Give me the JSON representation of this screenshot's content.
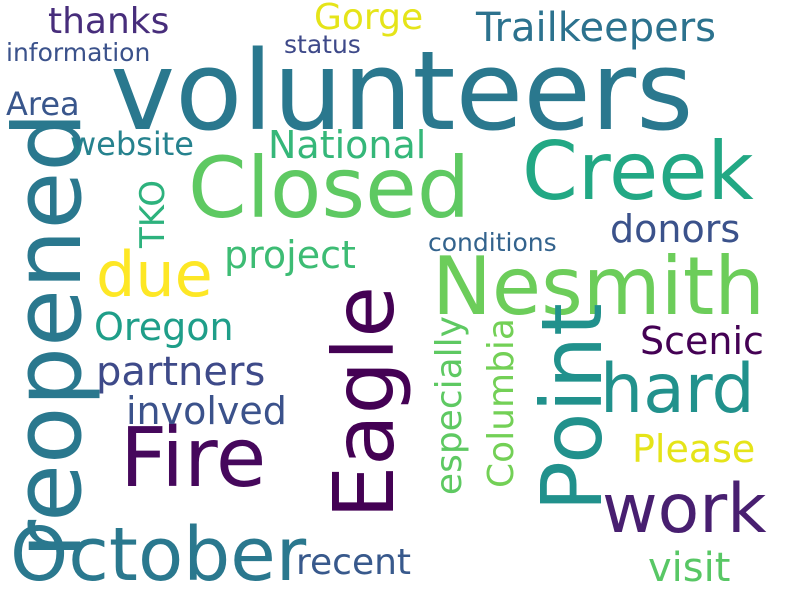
{
  "wordcloud": {
    "words": [
      {
        "text": "volunteers",
        "color": "#2a788e"
      },
      {
        "text": "reopened",
        "color": "#2a788e"
      },
      {
        "text": "Closed",
        "color": "#5ec962"
      },
      {
        "text": "Nesmith",
        "color": "#6ccd5a"
      },
      {
        "text": "Creek",
        "color": "#22a884"
      },
      {
        "text": "Point",
        "color": "#21918c"
      },
      {
        "text": "Eagle",
        "color": "#440154"
      },
      {
        "text": "Fire",
        "color": "#46085c"
      },
      {
        "text": "October",
        "color": "#2a788e"
      },
      {
        "text": "work",
        "color": "#481f70"
      },
      {
        "text": "hard",
        "color": "#21918c"
      },
      {
        "text": "due",
        "color": "#fde725"
      },
      {
        "text": "thanks",
        "color": "#472d7b"
      },
      {
        "text": "Gorge",
        "color": "#e5e419"
      },
      {
        "text": "Trailkeepers",
        "color": "#2c728e"
      },
      {
        "text": "information",
        "color": "#3b528b"
      },
      {
        "text": "status",
        "color": "#3e4989"
      },
      {
        "text": "Area",
        "color": "#39568c"
      },
      {
        "text": "website",
        "color": "#26828e"
      },
      {
        "text": "National",
        "color": "#35b779"
      },
      {
        "text": "TKO",
        "color": "#2db27d"
      },
      {
        "text": "donors",
        "color": "#3b528b"
      },
      {
        "text": "conditions",
        "color": "#33638d"
      },
      {
        "text": "project",
        "color": "#3dbc74"
      },
      {
        "text": "Oregon",
        "color": "#1f9e89"
      },
      {
        "text": "partners",
        "color": "#3e4a89"
      },
      {
        "text": "Scenic",
        "color": "#440154"
      },
      {
        "text": "involved",
        "color": "#3b528b"
      },
      {
        "text": "especially",
        "color": "#5ec962"
      },
      {
        "text": "Columbia",
        "color": "#73d056"
      },
      {
        "text": "Please",
        "color": "#e5e419"
      },
      {
        "text": "recent",
        "color": "#38598c"
      },
      {
        "text": "visit",
        "color": "#58c765"
      }
    ]
  }
}
